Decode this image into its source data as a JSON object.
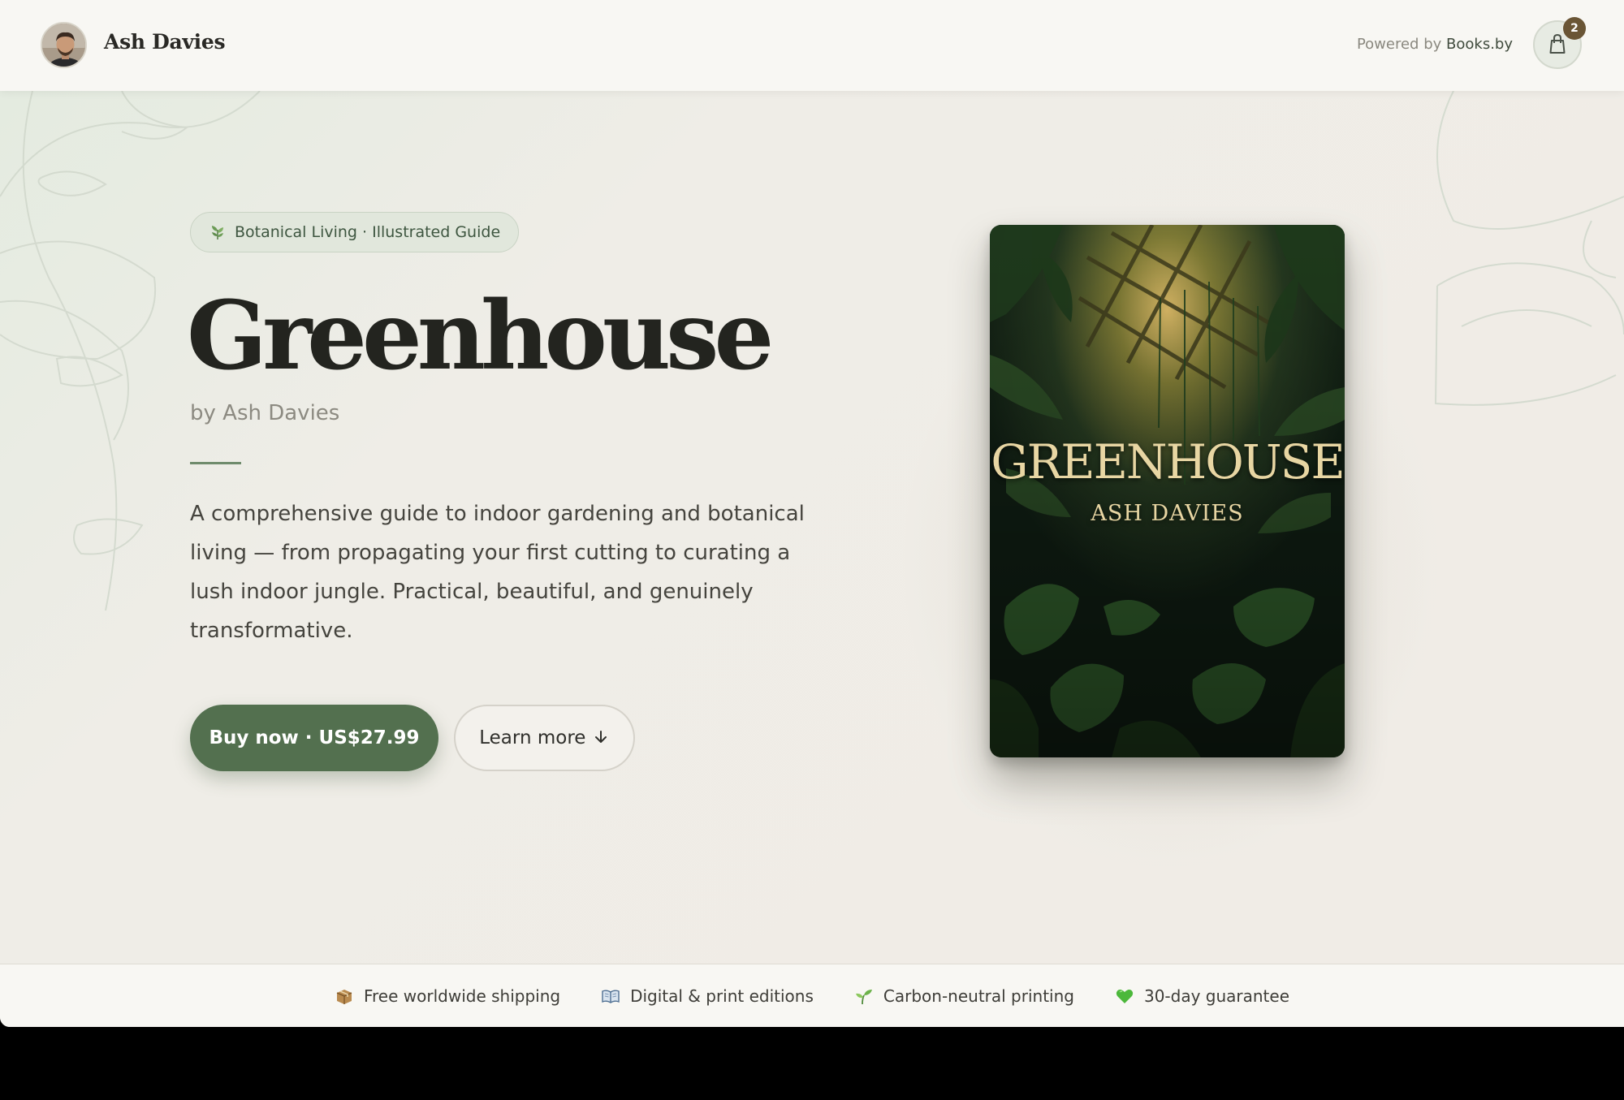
{
  "header": {
    "author_name": "Ash Davies",
    "powered_prefix": "Powered by",
    "powered_brand": "Books.by",
    "cart_count": "2"
  },
  "hero": {
    "tag": "Botanical Living · Illustrated Guide",
    "title": "Greenhouse",
    "byline": "by Ash Davies",
    "description": "A comprehensive guide to indoor gardening and botanical living — from propagating your first cutting to curating a lush indoor jungle. Practical, beautiful, and genuinely transformative.",
    "buy_label": "Buy now · US$27.99",
    "learn_label": "Learn more"
  },
  "cover": {
    "title": "GREENHOUSE",
    "author": "ASH DAVIES"
  },
  "features": [
    {
      "icon": "package-icon",
      "label": "Free worldwide shipping"
    },
    {
      "icon": "open-book-icon",
      "label": "Digital & print editions"
    },
    {
      "icon": "seedling-icon",
      "label": "Carbon-neutral printing"
    },
    {
      "icon": "green-heart-icon",
      "label": "30-day guarantee"
    }
  ],
  "colors": {
    "accent": "#53704f",
    "badge": "#6a5535",
    "page_bg": "#efede8",
    "title_text": "#23241f"
  }
}
